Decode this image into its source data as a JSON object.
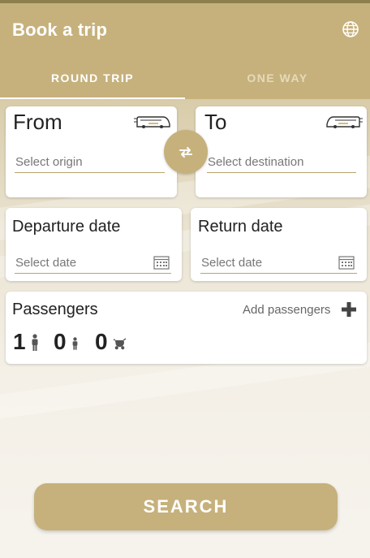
{
  "header": {
    "title": "Book a trip",
    "language_icon": "globe-icon"
  },
  "tabs": [
    {
      "label": "ROUND TRIP",
      "selected": true
    },
    {
      "label": "ONE WAY",
      "selected": false
    }
  ],
  "from": {
    "label": "From",
    "placeholder": "Select origin",
    "icon": "bus-icon"
  },
  "to": {
    "label": "To",
    "placeholder": "Select destination",
    "icon": "bus-icon"
  },
  "swap_icon": "swap-icon",
  "departure": {
    "label": "Departure date",
    "placeholder": "Select date",
    "icon": "calendar-icon"
  },
  "return": {
    "label": "Return date",
    "placeholder": "Select date",
    "icon": "calendar-icon"
  },
  "passengers": {
    "label": "Passengers",
    "add_label": "Add passengers",
    "add_icon": "plus-icon",
    "counts": [
      {
        "value": "1",
        "icon": "adult-icon"
      },
      {
        "value": "0",
        "icon": "child-icon"
      },
      {
        "value": "0",
        "icon": "stroller-icon"
      }
    ]
  },
  "search": {
    "label": "SEARCH"
  },
  "colors": {
    "primary": "#c6b17c",
    "primary_dark": "#8e7f4f",
    "background": "#f3efe6"
  }
}
